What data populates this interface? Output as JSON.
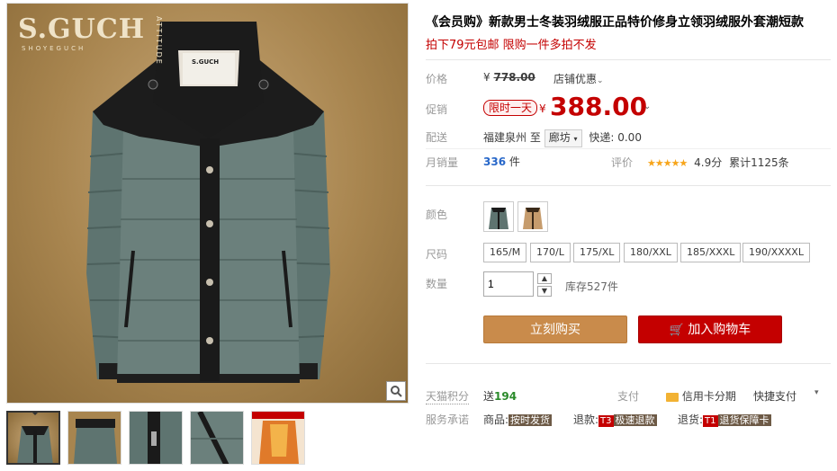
{
  "gallery": {
    "brand_big": "S.GUCH",
    "brand_small": "SHOYEGUCH",
    "brand_side": "ATTITUDE",
    "label_patch": "S.GUCH",
    "thumbnails": [
      "thumb-1",
      "thumb-2",
      "thumb-3",
      "thumb-4",
      "thumb-5"
    ]
  },
  "product": {
    "title": "《会员购》新款男士冬装羽绒服正品特价修身立领羽绒服外套潮短款",
    "promo": "拍下79元包邮 限购一件多拍不发"
  },
  "price": {
    "label": "价格",
    "currency": "¥",
    "original": "778.00",
    "store_discount": "店铺优惠"
  },
  "promotion": {
    "label": "促销",
    "tag": "限时一天",
    "currency": "¥",
    "price": "388.00"
  },
  "delivery": {
    "label": "配送",
    "from": "福建泉州",
    "to_word": "至",
    "destination": "廊坊",
    "shipping": "快递: 0.00"
  },
  "sales": {
    "label": "月销量",
    "count": "336",
    "unit": "件",
    "rating_label": "评价",
    "score": "4.9分",
    "total_reviews": "累计1125条"
  },
  "options": {
    "color_label": "颜色",
    "size_label": "尺码",
    "sizes": [
      "165/M",
      "170/L",
      "175/XL",
      "180/XXL",
      "185/XXXL",
      "190/XXXXL"
    ],
    "qty_label": "数量",
    "qty_value": "1",
    "stock": "库存527件"
  },
  "actions": {
    "buy_now": "立刻购买",
    "add_to_cart": "加入购物车"
  },
  "footer": {
    "points_label": "天猫积分",
    "points_text": "送",
    "points_value": "194",
    "pay_label": "支付",
    "credit_card": "信用卡分期",
    "quick_pay": "快捷支付",
    "service_label": "服务承诺",
    "goods_label": "商品:",
    "goods_tag": "按时发货",
    "refund_label": "退款:",
    "refund_num": "T3",
    "refund_tag": "极速退款",
    "return_label": "退货:",
    "return_num": "T1",
    "return_tag": "退货保障卡"
  }
}
